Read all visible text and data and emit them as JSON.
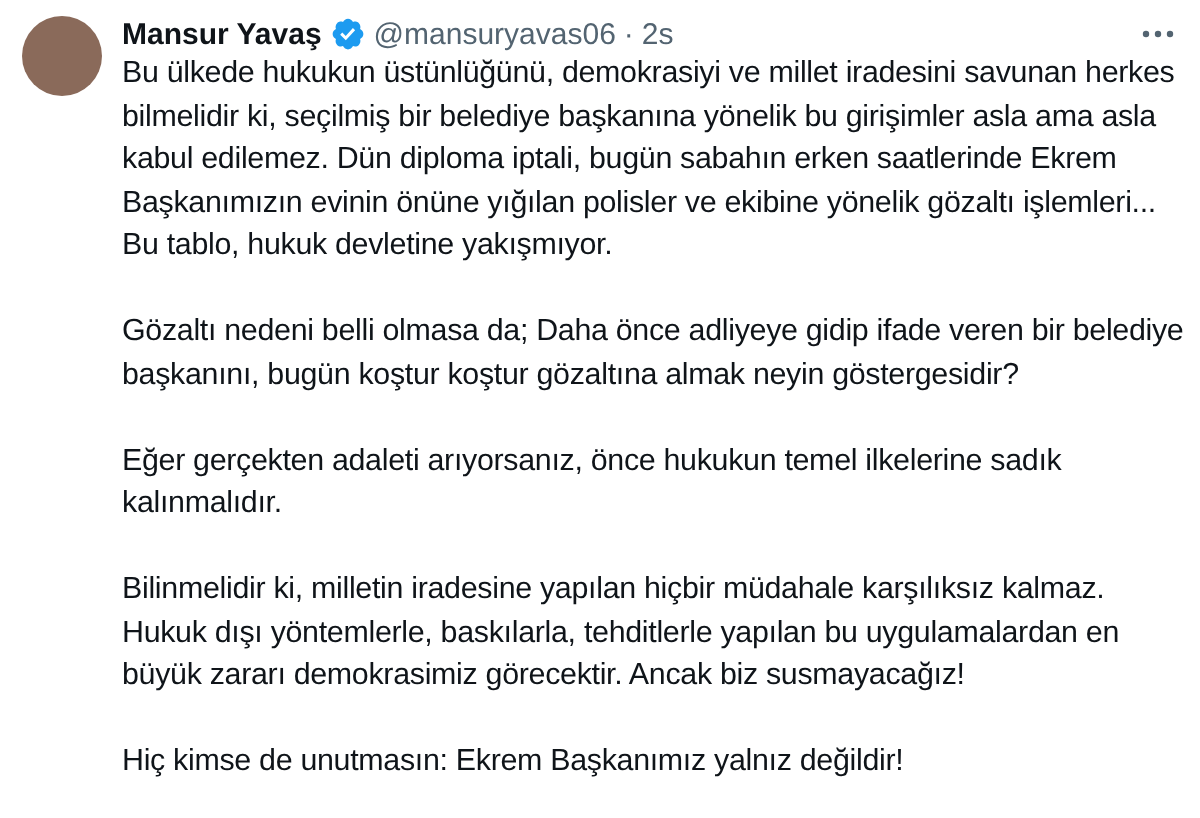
{
  "author": {
    "name": "Mansur Yavaş",
    "verified": true,
    "handle": "@mansuryavas06",
    "separator": "·",
    "time": "2s"
  },
  "paragraphs": [
    "Bu ülkede hukukun üstünlüğünü, demokrasiyi ve millet iradesini savunan herkes bilmelidir ki, seçilmiş bir belediye başkanına yönelik bu girişimler asla ama asla kabul edilemez. Dün diploma iptali, bugün sabahın erken saatlerinde Ekrem Başkanımızın evinin önüne yığılan polisler ve ekibine yönelik gözaltı işlemleri... Bu tablo, hukuk devletine yakışmıyor.",
    "Gözaltı nedeni belli olmasa da; Daha önce adliyeye gidip ifade veren bir belediye başkanını, bugün koştur koştur gözaltına almak neyin göstergesidir?",
    "Eğer gerçekten adaleti arıyorsanız, önce hukukun temel ilkelerine sadık kalınmalıdır.",
    "Bilinmelidir ki, milletin iradesine yapılan hiçbir müdahale karşılıksız kalmaz. Hukuk dışı yöntemlerle, baskılarla, tehditlerle yapılan bu uygulamalardan en büyük zararı demokrasimiz görecektir. Ancak biz susmayacağız!",
    "Hiç kimse de unutmasın: Ekrem Başkanımız yalnız değildir!"
  ]
}
